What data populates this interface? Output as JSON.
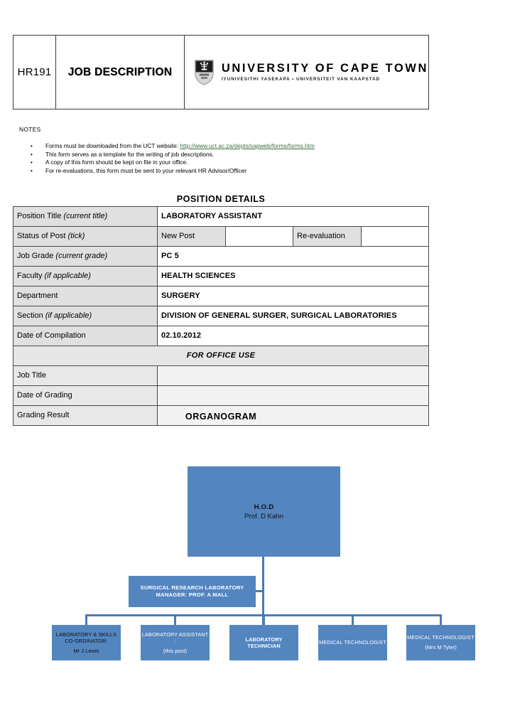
{
  "header": {
    "form_code": "HR191",
    "form_title": "JOB DESCRIPTION",
    "institution": "UNIVERSITY OF CAPE TOWN",
    "institution_sub": "IYUNIVESITHI YASEKAPA • UNIVERSITEIT VAN KAAPSTAD",
    "logo_icon": "uct-shield-icon"
  },
  "notes": {
    "label": "NOTES",
    "bullet": "•",
    "items": [
      {
        "pre": "Forms must be downloaded from the UCT website: ",
        "link": "http://www.uct.ac.za/depts/sapweb/forms/forms.htm"
      },
      {
        "pre": "This form serves as a template for the writing of job descriptions.",
        "link": ""
      },
      {
        "pre": "A copy of this form should be kept on file in your office.",
        "link": ""
      },
      {
        "pre": "For re-evaluations, this form must be sent to your relevant HR Advisor/Officer",
        "link": ""
      }
    ]
  },
  "position_details": {
    "heading": "POSITION DETAILS",
    "rows": [
      {
        "label_main": "Position Title ",
        "label_italic": "(current title)",
        "value": "LABORATORY ASSISTANT"
      },
      {
        "label_main": "Status of Post ",
        "label_italic": "(tick)",
        "option_a": "New Post",
        "option_b": "Re-evaluation",
        "tick_a": "",
        "tick_b": ""
      },
      {
        "label_main": "Job Grade ",
        "label_italic": "(current grade)",
        "value": "PC 5"
      },
      {
        "label_main": "Faculty ",
        "label_italic": "(if applicable)",
        "value": "HEALTH SCIENCES"
      },
      {
        "label_main": "Department",
        "label_italic": "",
        "value": "SURGERY"
      },
      {
        "label_main": "Section ",
        "label_italic": "(if applicable)",
        "value": "DIVISION OF GENERAL SURGER, SURGICAL LABORATORIES"
      },
      {
        "label_main": "Date of Compilation",
        "label_italic": "",
        "value": "02.10.2012"
      }
    ],
    "office_use": {
      "heading": "FOR OFFICE USE",
      "rows": [
        {
          "label": "Job Title",
          "value": ""
        },
        {
          "label": "Date of Grading",
          "value": ""
        },
        {
          "label": "Grading Result",
          "value": ""
        }
      ]
    }
  },
  "organogram": {
    "heading": "ORGANOGRAM",
    "box_color": "#5385bf",
    "line_color": "#4a7cb5",
    "hod": {
      "title": "H.O.D",
      "name": "Prof. D Kahn"
    },
    "manager": {
      "title": "SURGICAL RESEARCH LABORATORY MANAGER: PROF. A MALL"
    },
    "leaves": [
      {
        "title": "LABORATORY & SKILLS CO-ORDINATOR:",
        "sub": "Mr J Lewis",
        "style": "dark"
      },
      {
        "title": "LABORATORY ASSISTANT :",
        "sub": "(this post)",
        "style": "light"
      },
      {
        "title": "LABORATORY TECHNICIAN",
        "sub": "",
        "style": "light-bold"
      },
      {
        "title": "MEDICAL TECHNOLOGIST",
        "sub": "",
        "style": "light"
      },
      {
        "title": "MEDICAL TECHNOLOGIST",
        "sub": "(Mrs M Tyler)",
        "style": "light"
      }
    ]
  }
}
